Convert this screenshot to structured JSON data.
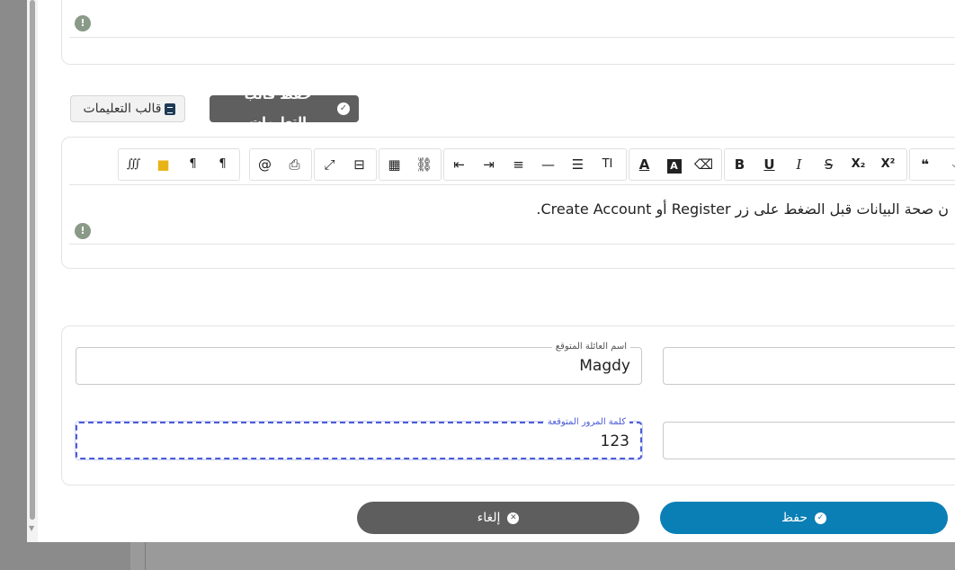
{
  "top_card": {
    "warning_icon": "warning-icon"
  },
  "buttons": {
    "instructions_template": "قالب التعليمات",
    "save_instructions_template": "حفظ قالب التعليمات",
    "cancel": "إلغاء",
    "save": "حفظ"
  },
  "toolbar": {
    "groups": [
      [
        "∭",
        "folder",
        "¶ltr",
        "¶rtl"
      ],
      [
        "@",
        "print"
      ],
      [
        "expand",
        "blocks"
      ],
      [
        "table",
        "link"
      ],
      [
        "outdent",
        "indent",
        "align",
        "hr",
        "ol",
        "TI"
      ],
      [
        "A-color",
        "A-bg",
        "eraser"
      ],
      [
        "B",
        "U",
        "I",
        "S",
        "X₂",
        "X²"
      ],
      [
        "quote",
        "more"
      ]
    ]
  },
  "editor": {
    "content": "ن صحة البيانات قبل الضغط على زر Register أو Create Account."
  },
  "form": {
    "family_name_label": "اسم العائلة المتوقع",
    "family_name_value": "Magdy",
    "code_label": "كلمة المرور المتوقعة",
    "code_value": "123"
  },
  "colors": {
    "save_button": "#0a7fb5",
    "cancel_button": "#5e5e5e",
    "focus_outline": "#4a5bd6"
  }
}
